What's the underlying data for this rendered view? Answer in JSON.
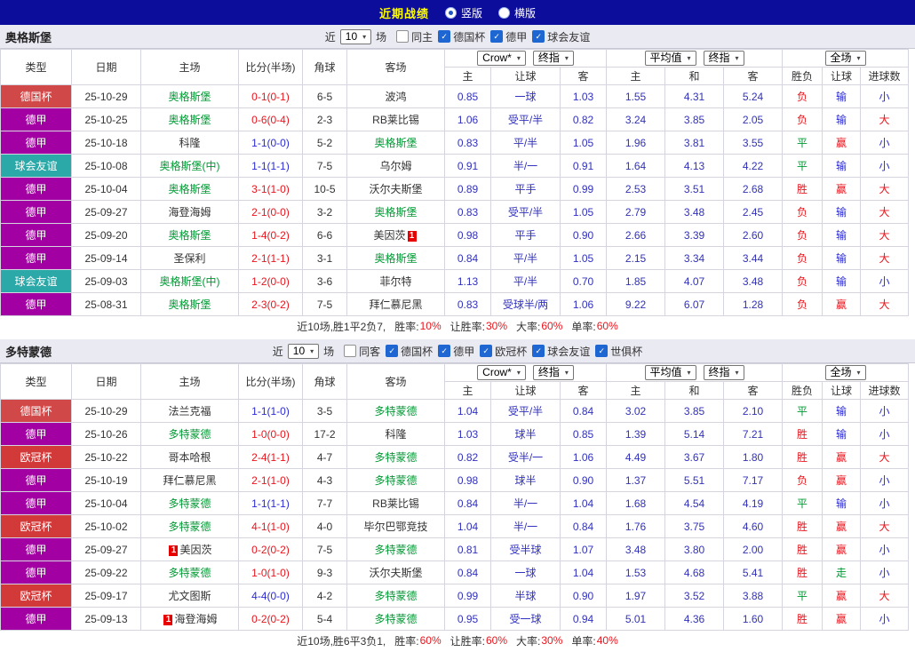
{
  "topbar": {
    "title": "近期战绩",
    "vertical": "竖版",
    "horizontal": "横版"
  },
  "labels": {
    "near": "近",
    "games": "场"
  },
  "table_header": {
    "cols": [
      "类型",
      "日期",
      "主场",
      "比分(半场)",
      "角球",
      "客场"
    ],
    "group1": {
      "select1": "Crow*",
      "select2": "终指",
      "subs": [
        "主",
        "让球",
        "客"
      ]
    },
    "group2": {
      "select1": "平均值",
      "select2": "终指",
      "subs": [
        "主",
        "和",
        "客"
      ]
    },
    "group3": {
      "select": "全场",
      "subs": [
        "胜负",
        "让球",
        "进球数"
      ]
    }
  },
  "type_colors": {
    "德国杯": "#d04848",
    "德甲": "#a300a3",
    "球会友谊": "#2ba8a8",
    "欧冠杯": "#d23a3a"
  },
  "result_colors": {
    "胜": "red",
    "平": "green",
    "负": "red",
    "赢": "red",
    "输": "blue",
    "走": "green",
    "大": "red",
    "小": "blue"
  },
  "colors": {
    "topbar_bg": "#0d0d9c",
    "title_yellow": "#ffff00",
    "team_green": "#009933",
    "odds_blue": "#3131bd",
    "result_red": "#e8151d",
    "draw_blue": "#2b2bd5",
    "section_bg": "#eaeaf3"
  },
  "sections": [
    {
      "team": "奥格斯堡",
      "filters": {
        "count": "10",
        "checkboxes": [
          {
            "label": "同主",
            "checked": false
          },
          {
            "label": "德国杯",
            "checked": true
          },
          {
            "label": "德甲",
            "checked": true
          },
          {
            "label": "球会友谊",
            "checked": true
          }
        ]
      },
      "rows": [
        {
          "type": "德国杯",
          "date": "25-10-29",
          "home": {
            "name": "奥格斯堡",
            "green": true
          },
          "score": "0-1(0-1)",
          "score_color": "red",
          "corners": "6-5",
          "away": {
            "name": "波鸿",
            "green": false
          },
          "handicap_odds": [
            "0.85",
            "一球",
            "1.03"
          ],
          "avg_odds": [
            "1.55",
            "4.31",
            "5.24"
          ],
          "results": [
            "负",
            "输",
            "小"
          ]
        },
        {
          "type": "德甲",
          "date": "25-10-25",
          "home": {
            "name": "奥格斯堡",
            "green": true
          },
          "score": "0-6(0-4)",
          "score_color": "red",
          "corners": "2-3",
          "away": {
            "name": "RB莱比锡",
            "green": false
          },
          "handicap_odds": [
            "1.06",
            "受平/半",
            "0.82"
          ],
          "avg_odds": [
            "3.24",
            "3.85",
            "2.05"
          ],
          "results": [
            "负",
            "输",
            "大"
          ]
        },
        {
          "type": "德甲",
          "date": "25-10-18",
          "home": {
            "name": "科隆",
            "green": false
          },
          "score": "1-1(0-0)",
          "score_color": "blue",
          "corners": "5-2",
          "away": {
            "name": "奥格斯堡",
            "green": true
          },
          "handicap_odds": [
            "0.83",
            "平/半",
            "1.05"
          ],
          "avg_odds": [
            "1.96",
            "3.81",
            "3.55"
          ],
          "results": [
            "平",
            "赢",
            "小"
          ]
        },
        {
          "type": "球会友谊",
          "date": "25-10-08",
          "home": {
            "name": "奥格斯堡(中)",
            "green": true
          },
          "score": "1-1(1-1)",
          "score_color": "blue",
          "corners": "7-5",
          "away": {
            "name": "乌尔姆",
            "green": false
          },
          "handicap_odds": [
            "0.91",
            "半/一",
            "0.91"
          ],
          "avg_odds": [
            "1.64",
            "4.13",
            "4.22"
          ],
          "results": [
            "平",
            "输",
            "小"
          ]
        },
        {
          "type": "德甲",
          "date": "25-10-04",
          "home": {
            "name": "奥格斯堡",
            "green": true
          },
          "score": "3-1(1-0)",
          "score_color": "red",
          "corners": "10-5",
          "away": {
            "name": "沃尔夫斯堡",
            "green": false
          },
          "handicap_odds": [
            "0.89",
            "平手",
            "0.99"
          ],
          "avg_odds": [
            "2.53",
            "3.51",
            "2.68"
          ],
          "results": [
            "胜",
            "赢",
            "大"
          ]
        },
        {
          "type": "德甲",
          "date": "25-09-27",
          "home": {
            "name": "海登海姆",
            "green": false
          },
          "score": "2-1(0-0)",
          "score_color": "red",
          "corners": "3-2",
          "away": {
            "name": "奥格斯堡",
            "green": true
          },
          "handicap_odds": [
            "0.83",
            "受平/半",
            "1.05"
          ],
          "avg_odds": [
            "2.79",
            "3.48",
            "2.45"
          ],
          "results": [
            "负",
            "输",
            "大"
          ]
        },
        {
          "type": "德甲",
          "date": "25-09-20",
          "home": {
            "name": "奥格斯堡",
            "green": true
          },
          "score": "1-4(0-2)",
          "score_color": "red",
          "corners": "6-6",
          "away": {
            "name": "美因茨",
            "green": false,
            "card_after": "1"
          },
          "handicap_odds": [
            "0.98",
            "平手",
            "0.90"
          ],
          "avg_odds": [
            "2.66",
            "3.39",
            "2.60"
          ],
          "results": [
            "负",
            "输",
            "大"
          ]
        },
        {
          "type": "德甲",
          "date": "25-09-14",
          "home": {
            "name": "圣保利",
            "green": false
          },
          "score": "2-1(1-1)",
          "score_color": "red",
          "corners": "3-1",
          "away": {
            "name": "奥格斯堡",
            "green": true
          },
          "handicap_odds": [
            "0.84",
            "平/半",
            "1.05"
          ],
          "avg_odds": [
            "2.15",
            "3.34",
            "3.44"
          ],
          "results": [
            "负",
            "输",
            "大"
          ]
        },
        {
          "type": "球会友谊",
          "date": "25-09-03",
          "home": {
            "name": "奥格斯堡(中)",
            "green": true
          },
          "score": "1-2(0-0)",
          "score_color": "red",
          "corners": "3-6",
          "away": {
            "name": "菲尔特",
            "green": false
          },
          "handicap_odds": [
            "1.13",
            "平/半",
            "0.70"
          ],
          "avg_odds": [
            "1.85",
            "4.07",
            "3.48"
          ],
          "results": [
            "负",
            "输",
            "小"
          ]
        },
        {
          "type": "德甲",
          "date": "25-08-31",
          "home": {
            "name": "奥格斯堡",
            "green": true
          },
          "score": "2-3(0-2)",
          "score_color": "red",
          "corners": "7-5",
          "away": {
            "name": "拜仁慕尼黑",
            "green": false
          },
          "handicap_odds": [
            "0.83",
            "受球半/两",
            "1.06"
          ],
          "avg_odds": [
            "9.22",
            "6.07",
            "1.28"
          ],
          "results": [
            "负",
            "赢",
            "大"
          ]
        }
      ],
      "summary": {
        "record": "近10场,胜1平2负7,",
        "stats": [
          {
            "label": "胜率:",
            "value": "10%"
          },
          {
            "label": "让胜率:",
            "value": "30%"
          },
          {
            "label": "大率:",
            "value": "60%"
          },
          {
            "label": "单率:",
            "value": "60%"
          }
        ]
      }
    },
    {
      "team": "多特蒙德",
      "filters": {
        "count": "10",
        "checkboxes": [
          {
            "label": "同客",
            "checked": false
          },
          {
            "label": "德国杯",
            "checked": true
          },
          {
            "label": "德甲",
            "checked": true
          },
          {
            "label": "欧冠杯",
            "checked": true
          },
          {
            "label": "球会友谊",
            "checked": true
          },
          {
            "label": "世俱杯",
            "checked": true
          }
        ]
      },
      "rows": [
        {
          "type": "德国杯",
          "date": "25-10-29",
          "home": {
            "name": "法兰克福",
            "green": false
          },
          "score": "1-1(1-0)",
          "score_color": "blue",
          "corners": "3-5",
          "away": {
            "name": "多特蒙德",
            "green": true
          },
          "handicap_odds": [
            "1.04",
            "受平/半",
            "0.84"
          ],
          "avg_odds": [
            "3.02",
            "3.85",
            "2.10"
          ],
          "results": [
            "平",
            "输",
            "小"
          ]
        },
        {
          "type": "德甲",
          "date": "25-10-26",
          "home": {
            "name": "多特蒙德",
            "green": true
          },
          "score": "1-0(0-0)",
          "score_color": "red",
          "corners": "17-2",
          "away": {
            "name": "科隆",
            "green": false
          },
          "handicap_odds": [
            "1.03",
            "球半",
            "0.85"
          ],
          "avg_odds": [
            "1.39",
            "5.14",
            "7.21"
          ],
          "results": [
            "胜",
            "输",
            "小"
          ]
        },
        {
          "type": "欧冠杯",
          "date": "25-10-22",
          "home": {
            "name": "哥本哈根",
            "green": false
          },
          "score": "2-4(1-1)",
          "score_color": "red",
          "corners": "4-7",
          "away": {
            "name": "多特蒙德",
            "green": true
          },
          "handicap_odds": [
            "0.82",
            "受半/一",
            "1.06"
          ],
          "avg_odds": [
            "4.49",
            "3.67",
            "1.80"
          ],
          "results": [
            "胜",
            "赢",
            "大"
          ]
        },
        {
          "type": "德甲",
          "date": "25-10-19",
          "home": {
            "name": "拜仁慕尼黑",
            "green": false
          },
          "score": "2-1(1-0)",
          "score_color": "red",
          "corners": "4-3",
          "away": {
            "name": "多特蒙德",
            "green": true
          },
          "handicap_odds": [
            "0.98",
            "球半",
            "0.90"
          ],
          "avg_odds": [
            "1.37",
            "5.51",
            "7.17"
          ],
          "results": [
            "负",
            "赢",
            "小"
          ]
        },
        {
          "type": "德甲",
          "date": "25-10-04",
          "home": {
            "name": "多特蒙德",
            "green": true
          },
          "score": "1-1(1-1)",
          "score_color": "blue",
          "corners": "7-7",
          "away": {
            "name": "RB莱比锡",
            "green": false
          },
          "handicap_odds": [
            "0.84",
            "半/一",
            "1.04"
          ],
          "avg_odds": [
            "1.68",
            "4.54",
            "4.19"
          ],
          "results": [
            "平",
            "输",
            "小"
          ]
        },
        {
          "type": "欧冠杯",
          "date": "25-10-02",
          "home": {
            "name": "多特蒙德",
            "green": true
          },
          "score": "4-1(1-0)",
          "score_color": "red",
          "corners": "4-0",
          "away": {
            "name": "毕尔巴鄂竞技",
            "green": false
          },
          "handicap_odds": [
            "1.04",
            "半/一",
            "0.84"
          ],
          "avg_odds": [
            "1.76",
            "3.75",
            "4.60"
          ],
          "results": [
            "胜",
            "赢",
            "大"
          ]
        },
        {
          "type": "德甲",
          "date": "25-09-27",
          "home": {
            "name": "美因茨",
            "green": false,
            "card_before": "1"
          },
          "score": "0-2(0-2)",
          "score_color": "red",
          "corners": "7-5",
          "away": {
            "name": "多特蒙德",
            "green": true
          },
          "handicap_odds": [
            "0.81",
            "受半球",
            "1.07"
          ],
          "avg_odds": [
            "3.48",
            "3.80",
            "2.00"
          ],
          "results": [
            "胜",
            "赢",
            "小"
          ]
        },
        {
          "type": "德甲",
          "date": "25-09-22",
          "home": {
            "name": "多特蒙德",
            "green": true
          },
          "score": "1-0(1-0)",
          "score_color": "red",
          "corners": "9-3",
          "away": {
            "name": "沃尔夫斯堡",
            "green": false
          },
          "handicap_odds": [
            "0.84",
            "一球",
            "1.04"
          ],
          "avg_odds": [
            "1.53",
            "4.68",
            "5.41"
          ],
          "results": [
            "胜",
            "走",
            "小"
          ]
        },
        {
          "type": "欧冠杯",
          "date": "25-09-17",
          "home": {
            "name": "尤文图斯",
            "green": false
          },
          "score": "4-4(0-0)",
          "score_color": "blue",
          "corners": "4-2",
          "away": {
            "name": "多特蒙德",
            "green": true
          },
          "handicap_odds": [
            "0.99",
            "半球",
            "0.90"
          ],
          "avg_odds": [
            "1.97",
            "3.52",
            "3.88"
          ],
          "results": [
            "平",
            "赢",
            "大"
          ]
        },
        {
          "type": "德甲",
          "date": "25-09-13",
          "home": {
            "name": "海登海姆",
            "green": false,
            "card_before": "1"
          },
          "score": "0-2(0-2)",
          "score_color": "red",
          "corners": "5-4",
          "away": {
            "name": "多特蒙德",
            "green": true
          },
          "handicap_odds": [
            "0.95",
            "受一球",
            "0.94"
          ],
          "avg_odds": [
            "5.01",
            "4.36",
            "1.60"
          ],
          "results": [
            "胜",
            "赢",
            "小"
          ]
        }
      ],
      "summary": {
        "record": "近10场,胜6平3负1,",
        "stats": [
          {
            "label": "胜率:",
            "value": "60%"
          },
          {
            "label": "让胜率:",
            "value": "60%"
          },
          {
            "label": "大率:",
            "value": "30%"
          },
          {
            "label": "单率:",
            "value": "40%"
          }
        ]
      }
    }
  ]
}
